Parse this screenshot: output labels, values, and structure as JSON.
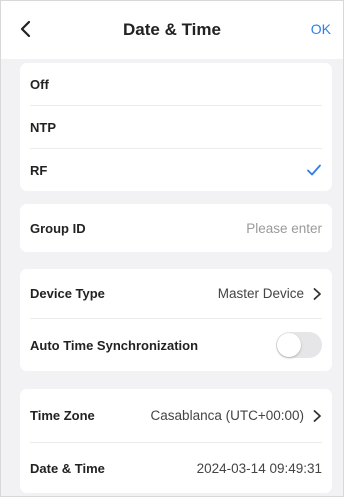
{
  "header": {
    "title": "Date & Time",
    "ok_label": "OK",
    "back_icon": "chevron-left-icon"
  },
  "sync_mode": {
    "options": [
      {
        "label": "Off"
      },
      {
        "label": "NTP"
      },
      {
        "label": "RF"
      }
    ],
    "selected": "RF"
  },
  "group": {
    "label": "Group ID",
    "placeholder": "Please enter"
  },
  "device": {
    "type_label": "Device Type",
    "type_value": "Master Device",
    "auto_sync_label": "Auto Time Synchronization",
    "auto_sync_on": false
  },
  "time": {
    "zone_label": "Time Zone",
    "zone_value": "Casablanca (UTC+00:00)",
    "datetime_label": "Date & Time",
    "datetime_value": "2024-03-14 09:49:31"
  },
  "colors": {
    "accent": "#2f7fe6",
    "background": "#f2f2f4",
    "card": "#ffffff"
  }
}
